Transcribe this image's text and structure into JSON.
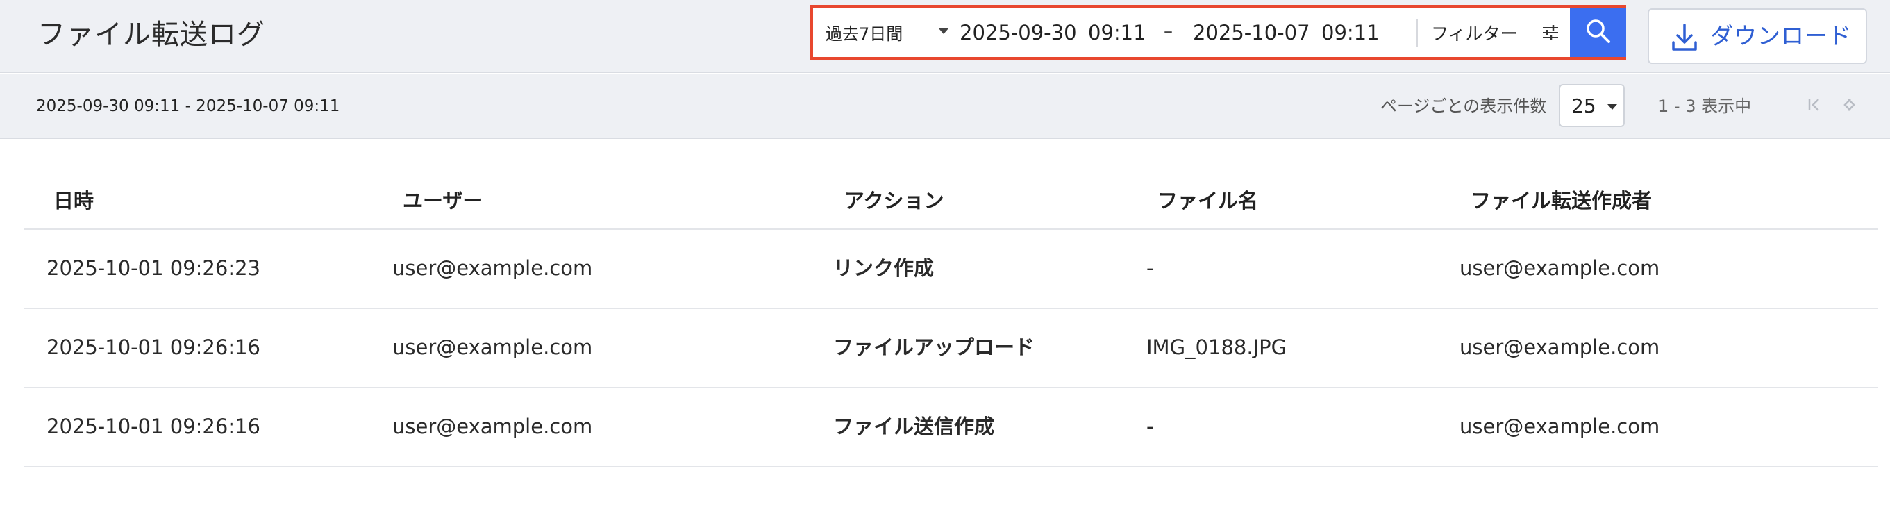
{
  "header": {
    "title": "ファイル転送ログ"
  },
  "search": {
    "range_option": "過去7日間",
    "start_date": "2025-09-30",
    "start_time": "09:11",
    "separator": "–",
    "end_date": "2025-10-07",
    "end_time": "09:11",
    "filter_label": "フィルター",
    "search_icon": "search-icon",
    "filter_icon": "sliders-icon"
  },
  "download": {
    "label": "ダウンロード",
    "icon": "download-icon"
  },
  "subbar": {
    "range_text": "2025-09-30 09:11 - 2025-10-07 09:11",
    "per_page_label": "ページごとの表示件数",
    "per_page_value": "25",
    "page_info": "1 - 3 表示中"
  },
  "table": {
    "columns": [
      "日時",
      "ユーザー",
      "アクション",
      "ファイル名",
      "ファイル転送作成者"
    ],
    "rows": [
      [
        "2025-10-01 09:26:23",
        "user@example.com",
        "リンク作成",
        "-",
        "user@example.com"
      ],
      [
        "2025-10-01 09:26:16",
        "user@example.com",
        "ファイルアップロード",
        "IMG_0188.JPG",
        "user@example.com"
      ],
      [
        "2025-10-01 09:26:16",
        "user@example.com",
        "ファイル送信作成",
        "-",
        "user@example.com"
      ]
    ]
  },
  "colors": {
    "accent": "#3b6ef0",
    "highlight_border": "#e8472f",
    "download_text": "#2f5fd3",
    "header_bg": "#eef0f4"
  }
}
